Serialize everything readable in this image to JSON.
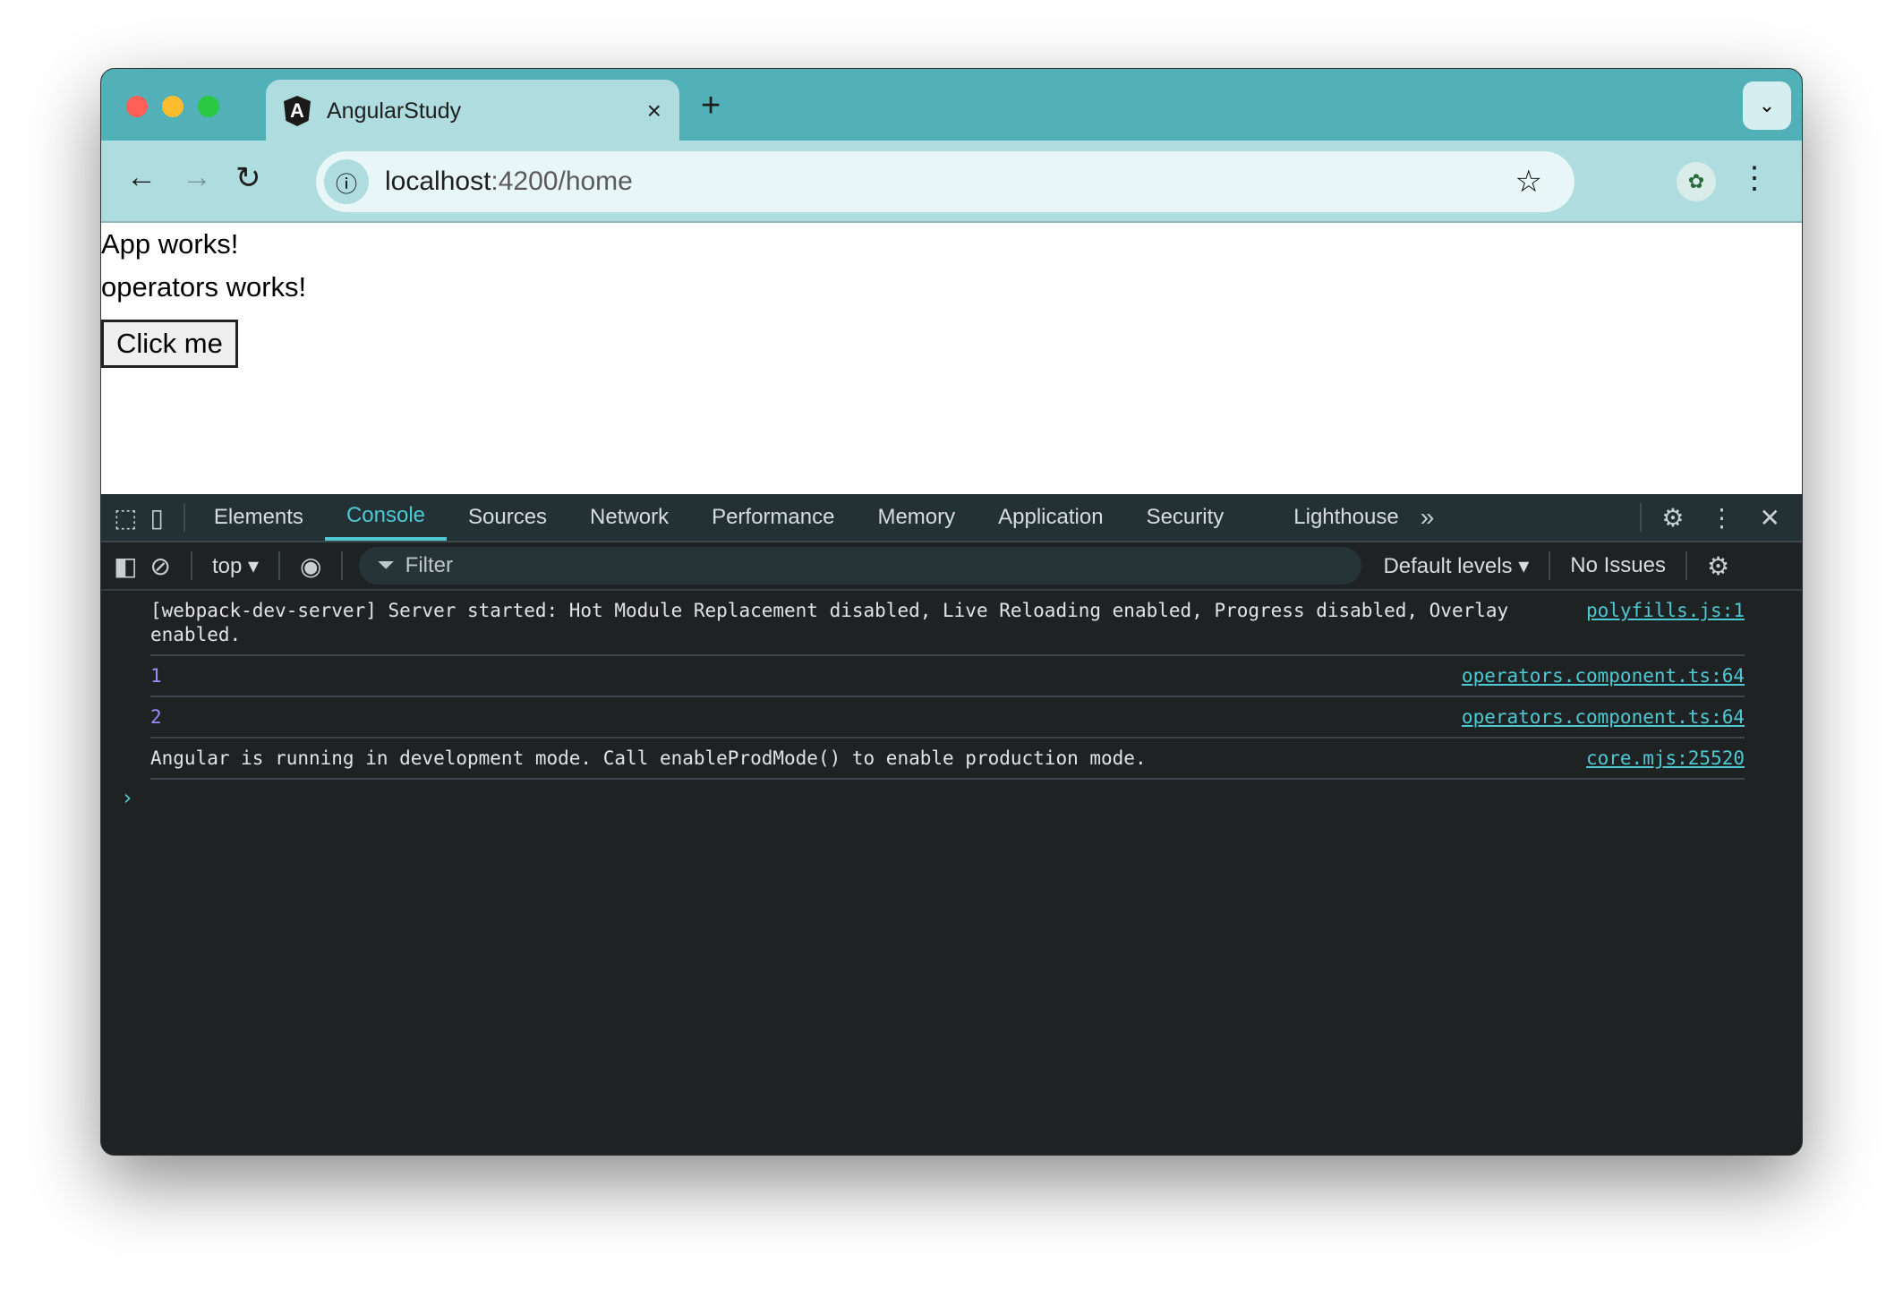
{
  "browser": {
    "tab_title": "AngularStudy",
    "tab_close": "×",
    "new_tab": "+",
    "url_host": "localhost",
    "url_path": ":4200/home"
  },
  "page": {
    "lines": [
      "App works!",
      "operators works!"
    ],
    "button_label": "Click me"
  },
  "devtools": {
    "tabs": [
      "Elements",
      "Console",
      "Sources",
      "Network",
      "Performance",
      "Memory",
      "Application",
      "Security",
      "Lighthouse"
    ],
    "active_tab": "Console",
    "more_tabs": "»",
    "context": "top ▾",
    "filter_placeholder": "Filter",
    "levels": "Default levels ▾",
    "issues": "No Issues"
  },
  "console": {
    "messages": [
      {
        "text": "[webpack-dev-server] Server started: Hot Module Replacement disabled, Live Reloading enabled, Progress disabled, Overlay enabled.",
        "source": "polyfills.js:1"
      },
      {
        "text": "1",
        "source": "operators.component.ts:64"
      },
      {
        "text": "2",
        "source": "operators.component.ts:64"
      },
      {
        "text": "Angular is running in development mode. Call enableProdMode() to enable production mode.",
        "source": "core.mjs:25520"
      }
    ],
    "prompt": "›"
  }
}
